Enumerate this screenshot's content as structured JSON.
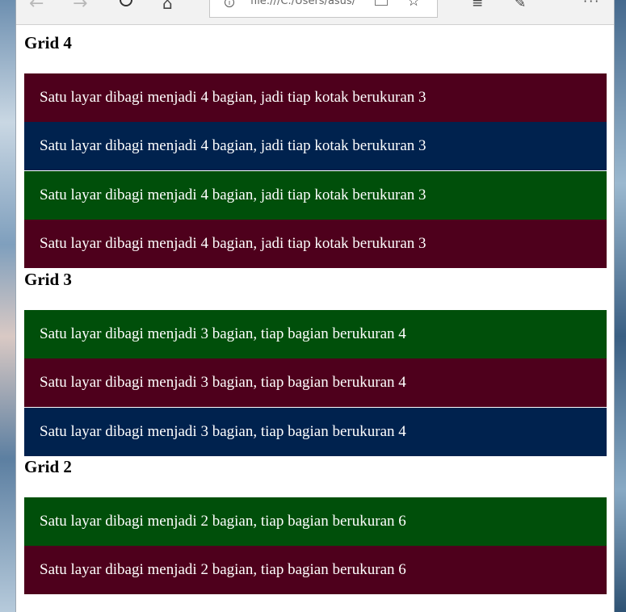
{
  "browser": {
    "address_text": "file:///C:/Users/asus/",
    "icons": [
      "back-arrow-icon",
      "forward-arrow-icon",
      "refresh-icon",
      "home-icon",
      "info-icon",
      "reading-view-icon",
      "favorite-star-icon",
      "hub-icon",
      "web-note-icon",
      "more-icon"
    ]
  },
  "colors": {
    "maroon": "#4e001c",
    "navy": "#00224e",
    "green": "#004f0a"
  },
  "sections": [
    {
      "title": "Grid 4",
      "rows": [
        {
          "text": "Satu layar dibagi menjadi 4 bagian, jadi tiap kotak berukuran 3",
          "color": "maroon"
        },
        {
          "text": "Satu layar dibagi menjadi 4 bagian, jadi tiap kotak berukuran 3",
          "color": "navy"
        },
        {
          "text": "Satu layar dibagi menjadi 4 bagian, jadi tiap kotak berukuran 3",
          "color": "green"
        },
        {
          "text": "Satu layar dibagi menjadi 4 bagian, jadi tiap kotak berukuran 3",
          "color": "maroon"
        }
      ]
    },
    {
      "title": "Grid 3",
      "rows": [
        {
          "text": "Satu layar dibagi menjadi 3 bagian, tiap bagian berukuran 4",
          "color": "green"
        },
        {
          "text": "Satu layar dibagi menjadi 3 bagian, tiap bagian berukuran 4",
          "color": "maroon"
        },
        {
          "text": "Satu layar dibagi menjadi 3 bagian, tiap bagian berukuran 4",
          "color": "navy"
        }
      ]
    },
    {
      "title": "Grid 2",
      "rows": [
        {
          "text": "Satu layar dibagi menjadi 2 bagian, tiap bagian berukuran 6",
          "color": "green"
        },
        {
          "text": "Satu layar dibagi menjadi 2 bagian, tiap bagian berukuran 6",
          "color": "maroon"
        }
      ]
    }
  ]
}
